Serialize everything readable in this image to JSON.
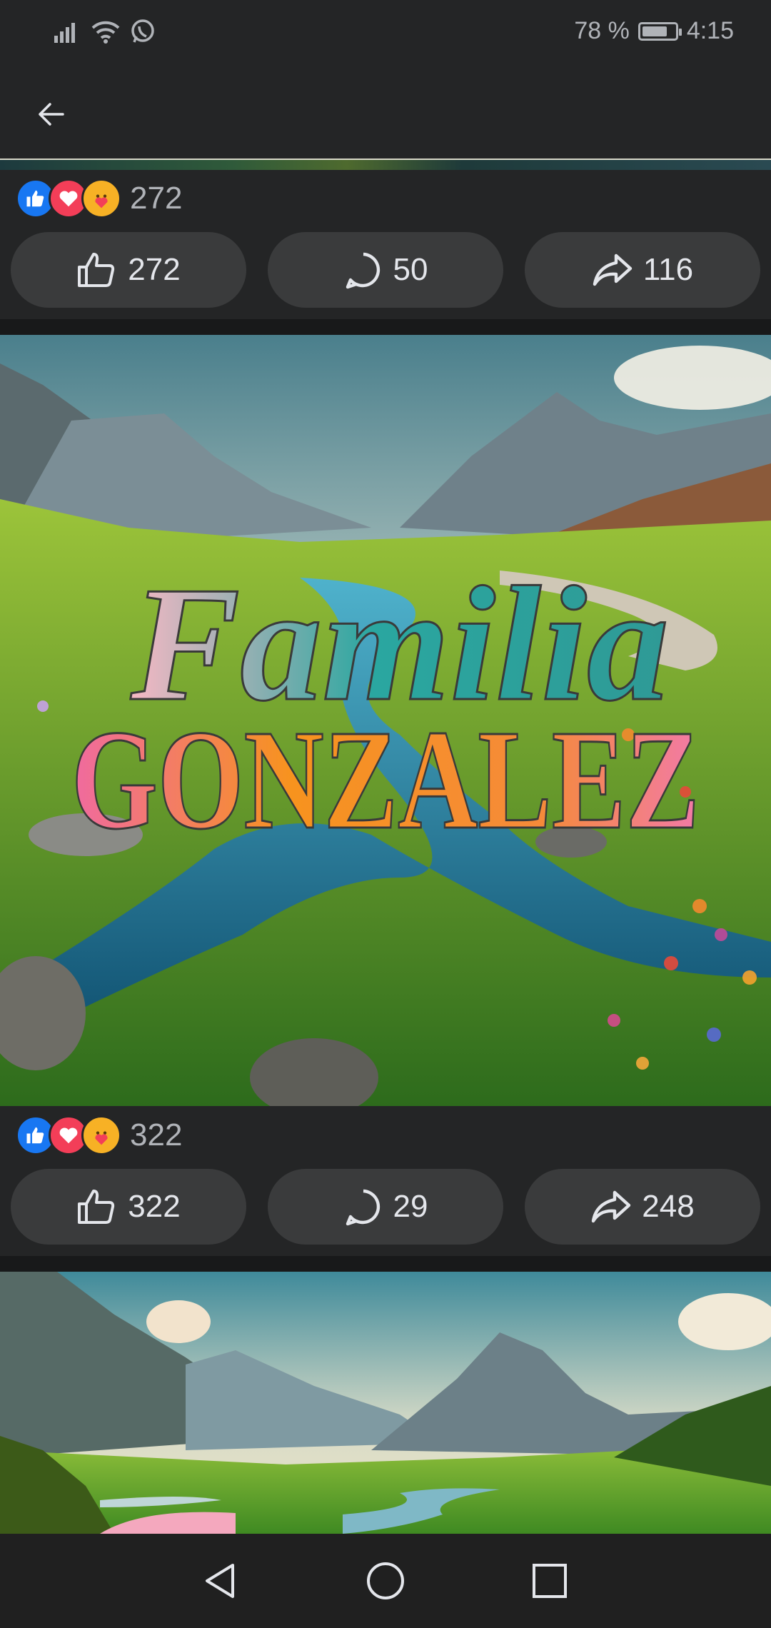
{
  "status_bar": {
    "battery": "78 %",
    "battery_level": 0.78,
    "time": "4:15",
    "icons": [
      "signal-icon",
      "wifi-icon",
      "whatsapp-icon",
      "battery-icon"
    ]
  },
  "app_bar": {
    "back_icon": "arrow-left-icon"
  },
  "posts": [
    {
      "reaction_total": "272",
      "reactions": [
        "like",
        "love",
        "care"
      ],
      "actions": {
        "like": "272",
        "comment": "50",
        "share": "116"
      }
    },
    {
      "photo_text_line1": "Familia",
      "photo_text_line2": "GONZALEZ",
      "reaction_total": "322",
      "reactions": [
        "like",
        "love",
        "care"
      ],
      "actions": {
        "like": "322",
        "comment": "29",
        "share": "248"
      }
    },
    {
      "photo": "mountain-valley-landscape"
    }
  ],
  "nav_bar": {
    "icons": [
      "back-triangle-icon",
      "home-circle-icon",
      "recents-square-icon"
    ]
  },
  "colors": {
    "background": "#242526",
    "button": "#3a3b3c",
    "like_blue": "#1877f2",
    "love_red": "#f33e58",
    "care_yellow": "#f7b125"
  }
}
